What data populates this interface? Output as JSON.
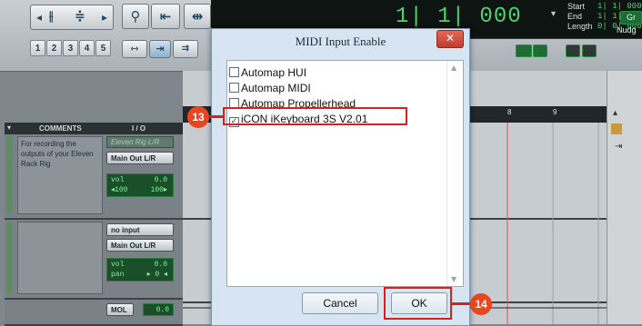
{
  "toolbar": {
    "grid_numbers": [
      "1",
      "2",
      "3",
      "4",
      "5"
    ],
    "main_counter": "1| 1| 000",
    "counter_dropdown": "▾",
    "start_label": "Start",
    "end_label": "End",
    "length_label": "Length",
    "start_value": "1| 1| 000",
    "end_value": "1| 1| 000",
    "length_value": "0| 0| 000",
    "green_btn": "Gr",
    "nudge_label": "Nudg"
  },
  "mixer": {
    "comments_header": "COMMENTS",
    "io_header": "I / O",
    "track1": {
      "comment": "For recording the outputs of your Eleven Rack Rig",
      "input": "Eleven Rig L/R",
      "output": "Main Out L/R",
      "vol_label": "vol",
      "vol_value": "0.0",
      "pan_left": "◂100",
      "pan_right": "100▸"
    },
    "track2": {
      "input": "no input",
      "output": "Main Out L/R",
      "vol_label": "vol",
      "vol_value": "0.0",
      "pan_label": "pan",
      "pan_value": "▸ 0 ◂"
    },
    "track3": {
      "output": "MOL",
      "vol_value": "0.0"
    }
  },
  "ruler": {
    "marker_8": "8",
    "marker_9": "9"
  },
  "dialog": {
    "title": "MIDI Input Enable",
    "close": "✕",
    "items": [
      {
        "label": "Automap HUI",
        "checked": false
      },
      {
        "label": "Automap MIDI",
        "checked": false
      },
      {
        "label": "Automap Propellerhead",
        "checked": false
      },
      {
        "label": "iCON iKeyboard 3S V2.01",
        "checked": true
      }
    ],
    "cancel_label": "Cancel",
    "ok_label": "OK"
  },
  "annotations": {
    "step13": "13",
    "step14": "14"
  },
  "colors": {
    "accent_red": "#d8211a",
    "callout": "#e8461e",
    "counter_green": "#4fd46c"
  }
}
